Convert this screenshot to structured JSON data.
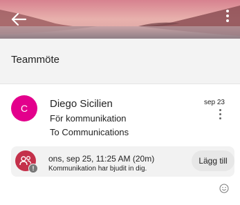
{
  "header": {
    "back_icon": "arrow-left-icon",
    "more_icon": "more-vertical-icon"
  },
  "thread": {
    "title": "Teammöte"
  },
  "message": {
    "avatar_initial": "C",
    "avatar_color": "#e3008c",
    "sender": "Diego Sicilien",
    "subject": "För kommunikation",
    "preview": "To Communications",
    "date": "sep 23",
    "more_icon": "more-vertical-icon"
  },
  "invite": {
    "icon": "group-calendar-icon",
    "icon_color": "#c4314b",
    "time": "ons, sep 25, 11:25 AM (20m)",
    "note": "Kommunikation har bjudit in dig.",
    "add_label": "Lägg till"
  },
  "reaction": {
    "icon": "emoji-icon"
  }
}
